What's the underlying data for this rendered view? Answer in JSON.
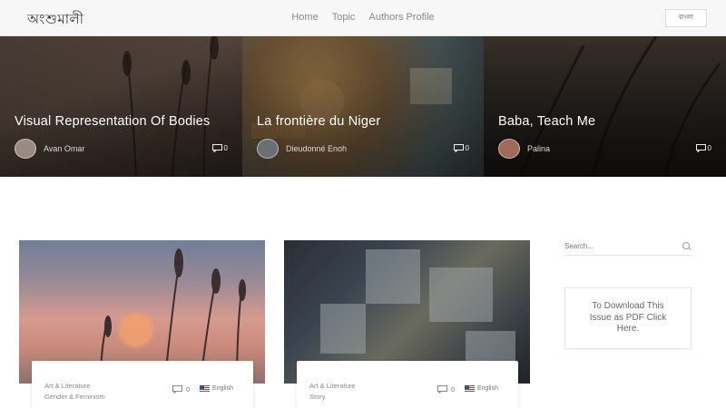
{
  "header": {
    "logo": "অংশুমালী",
    "nav": [
      "Home",
      "Topic",
      "Authors Profile"
    ],
    "lang_button": "বাংলা"
  },
  "hero": [
    {
      "title": "Visual Representation Of Bodies",
      "author": "Avan Omar",
      "comments": "0"
    },
    {
      "title": "La frontière du Niger",
      "author": "Dieudonné Enoh",
      "comments": "0"
    },
    {
      "title": "Baba, Teach Me",
      "author": "Palina",
      "comments": "0"
    }
  ],
  "posts": [
    {
      "tags": [
        "Art & Literature",
        "Gender & Feminism"
      ],
      "comments": "0",
      "language": "English"
    },
    {
      "tags": [
        "Art & Literature",
        "Story"
      ],
      "comments": "0",
      "language": "English"
    }
  ],
  "sidebar": {
    "search_placeholder": "Search...",
    "pdf_text": "To Download This Issue as PDF Click Here."
  }
}
